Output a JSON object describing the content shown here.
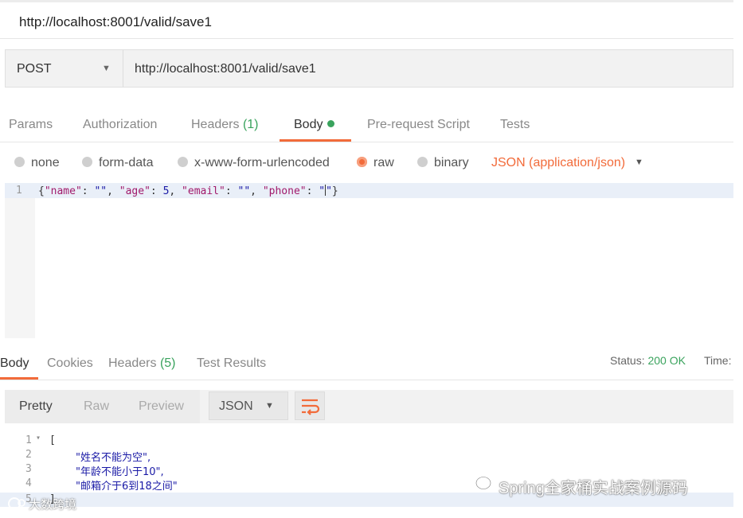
{
  "title_bar": {
    "title": "http://localhost:8001/valid/save1"
  },
  "request": {
    "method": "POST",
    "url": "http://localhost:8001/valid/save1"
  },
  "request_tabs": {
    "params": "Params",
    "authorization": "Authorization",
    "headers": "Headers",
    "headers_count": "(1)",
    "body": "Body",
    "prerequest": "Pre-request Script",
    "tests": "Tests"
  },
  "body_modes": {
    "none": "none",
    "form_data": "form-data",
    "urlencoded": "x-www-form-urlencoded",
    "raw": "raw",
    "binary": "binary",
    "selected": "raw",
    "content_type": "JSON (application/json)"
  },
  "editor": {
    "line_number": "1",
    "tokens": {
      "open": "{",
      "k_name": "\"name\"",
      "sep1": ": ",
      "v_name": "\"\"",
      "comma1": ", ",
      "k_age": "\"age\"",
      "sep2": ": ",
      "v_age": "5",
      "comma2": ", ",
      "k_email": "\"email\"",
      "sep3": ": ",
      "v_email": "\"\"",
      "comma3": ", ",
      "k_phone": "\"phone\"",
      "sep4": ": ",
      "v_phone_a": "\"",
      "v_phone_b": "\"",
      "close": "}"
    }
  },
  "response_tabs": {
    "body": "Body",
    "cookies": "Cookies",
    "headers": "Headers",
    "headers_count": "(5)",
    "test_results": "Test Results",
    "status_label": "Status:",
    "status_value": "200 OK",
    "time_label": "Time:"
  },
  "response_toolbar": {
    "pretty": "Pretty",
    "raw": "Raw",
    "preview": "Preview",
    "format": "JSON"
  },
  "response_body": {
    "lines": [
      {
        "num": "1",
        "text": "["
      },
      {
        "num": "2",
        "text": "\"姓名不能为空\","
      },
      {
        "num": "3",
        "text": "\"年龄不能小于10\","
      },
      {
        "num": "4",
        "text": "\"邮箱介于6到18之间\""
      },
      {
        "num": "5",
        "text": "]"
      }
    ]
  },
  "watermarks": {
    "wechat": "Spring全家桶实战案例源码",
    "corner": "大数跨境"
  },
  "colors": {
    "accent": "#f26b3a",
    "success": "#3aa35d",
    "string": "#1a1aa6",
    "key": "#a11a6b"
  }
}
